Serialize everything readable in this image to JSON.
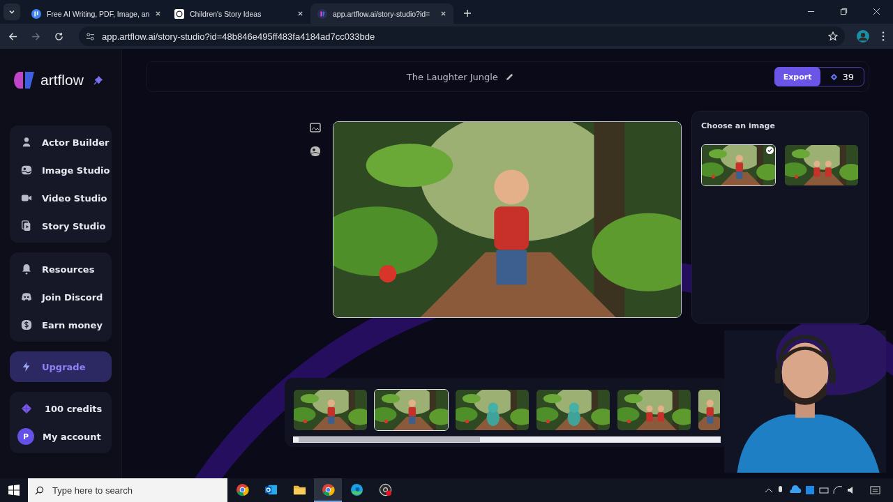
{
  "browser": {
    "tabs": [
      {
        "title": "Free AI Writing, PDF, Image, an",
        "selected": false
      },
      {
        "title": "Children's Story Ideas",
        "selected": false
      },
      {
        "title": "app.artflow.ai/story-studio?id=",
        "selected": true
      }
    ],
    "url": "app.artflow.ai/story-studio?id=48b846e495ff483fa4184ad7cc033bde"
  },
  "sidebar": {
    "logo": "artflow",
    "groups": [
      [
        {
          "label": "Actor Builder"
        },
        {
          "label": "Image Studio"
        },
        {
          "label": "Video Studio"
        },
        {
          "label": "Story Studio"
        }
      ],
      [
        {
          "label": "Resources"
        },
        {
          "label": "Join Discord"
        },
        {
          "label": "Earn money"
        }
      ]
    ],
    "upgrade": "Upgrade",
    "credits": "100 credits",
    "account": {
      "initial": "P",
      "label": "My account"
    }
  },
  "header": {
    "title": "The Laughter Jungle",
    "export": "Export",
    "credits": "39"
  },
  "image_picker": {
    "title": "Choose an image",
    "options": [
      {
        "selected": true
      },
      {
        "selected": false
      }
    ]
  },
  "filmstrip": {
    "frames": [
      {
        "selected": false
      },
      {
        "selected": true
      },
      {
        "selected": false
      },
      {
        "selected": false
      },
      {
        "selected": false
      },
      {
        "selected": false
      }
    ]
  },
  "taskbar": {
    "search_placeholder": "Type here to search",
    "apps": [
      {
        "selected": false
      },
      {
        "selected": false
      },
      {
        "selected": false
      },
      {
        "selected": true
      },
      {
        "selected": false
      },
      {
        "selected": false
      }
    ]
  }
}
